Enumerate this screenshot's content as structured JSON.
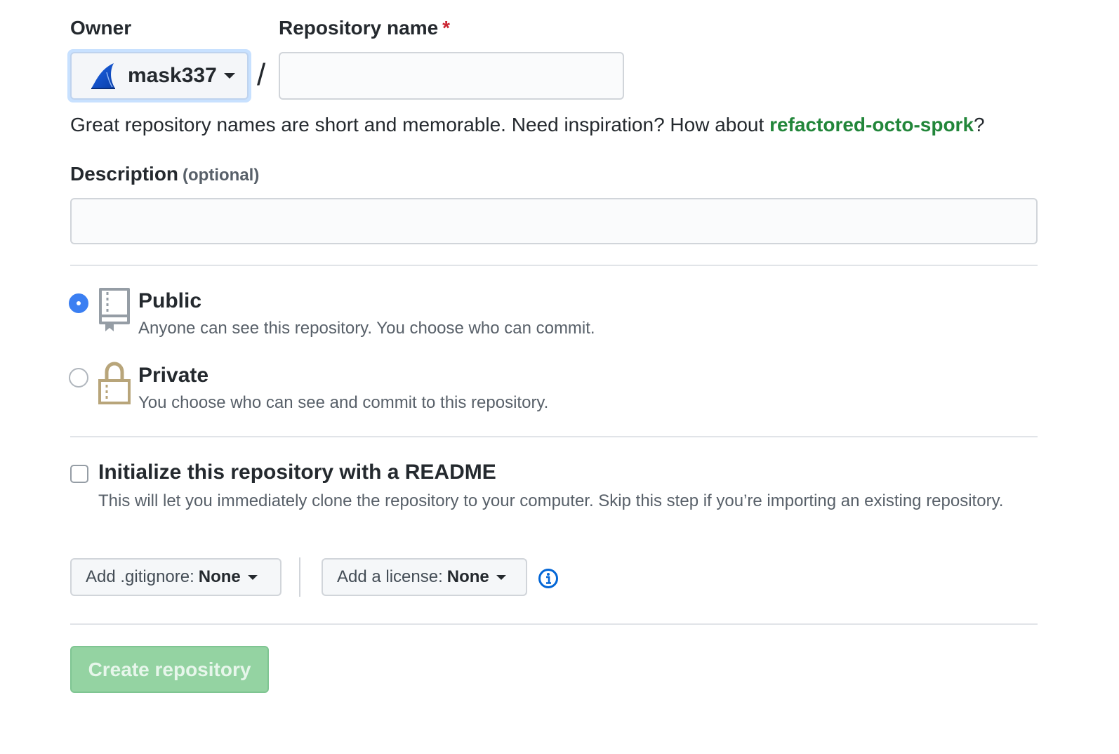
{
  "owner": {
    "label": "Owner",
    "selected": "mask337",
    "avatar_icon": "shark-fin-avatar"
  },
  "repo_name": {
    "label": "Repository name",
    "required_mark": "*",
    "value": "",
    "separator": "/"
  },
  "hint": {
    "prefix": "Great repository names are short and memorable. Need inspiration? How about ",
    "suggestion": "refactored-octo-spork",
    "suffix": "?"
  },
  "description": {
    "label": "Description",
    "optional": "(optional)",
    "value": ""
  },
  "visibility": {
    "selected": "public",
    "options": [
      {
        "id": "public",
        "title": "Public",
        "desc": "Anyone can see this repository. You choose who can commit.",
        "icon": "repo-book-icon"
      },
      {
        "id": "private",
        "title": "Private",
        "desc": "You choose who can see and commit to this repository.",
        "icon": "lock-icon"
      }
    ]
  },
  "init_readme": {
    "checked": false,
    "title": "Initialize this repository with a README",
    "desc": "This will let you immediately clone the repository to your computer. Skip this step if you’re importing an existing repository."
  },
  "gitignore": {
    "label": "Add .gitignore:",
    "value": "None"
  },
  "license": {
    "label": "Add a license:",
    "value": "None"
  },
  "create_button": {
    "label": "Create repository",
    "enabled": false
  },
  "colors": {
    "accent_blue": "#3b7ff2",
    "link_green": "#22863a",
    "required_red": "#cb2431",
    "disabled_button": "#94d3a2"
  }
}
